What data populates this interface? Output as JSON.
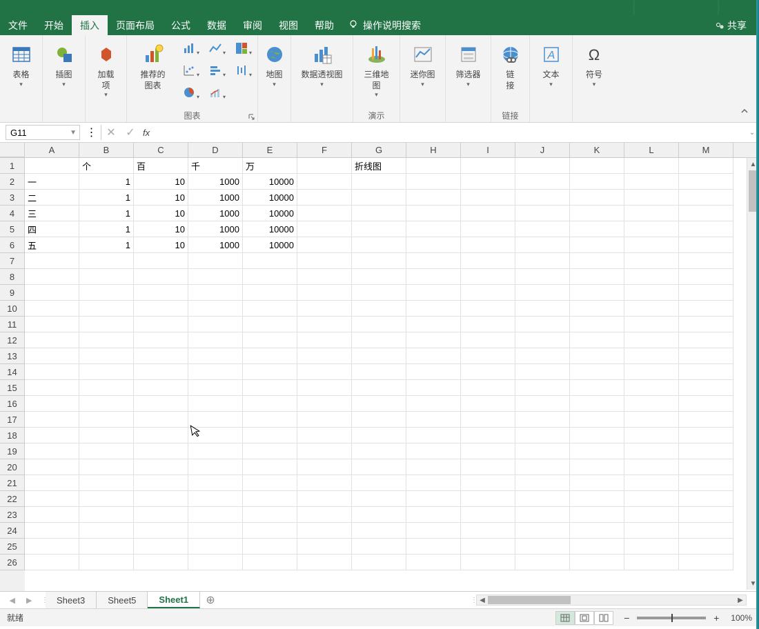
{
  "menubar": {
    "items": [
      "文件",
      "开始",
      "插入",
      "页面布局",
      "公式",
      "数据",
      "审阅",
      "视图",
      "帮助"
    ],
    "active_index": 2,
    "search_placeholder": "操作说明搜索",
    "share_label": "共享"
  },
  "ribbon": {
    "groups": {
      "tables": {
        "btn_table": "表格"
      },
      "illustrations": {
        "btn_pictures": "插图"
      },
      "addins": {
        "btn_addins": "加载\n项"
      },
      "charts": {
        "label": "图表",
        "btn_recommended": "推荐的\n图表"
      },
      "maps": {
        "btn_maps": "地图"
      },
      "pivot": {
        "btn_pivot": "数据透视图"
      },
      "tours": {
        "label": "演示",
        "btn_3dmap": "三维地\n图"
      },
      "sparklines": {
        "btn_sparklines": "迷你图"
      },
      "filters": {
        "btn_slicer": "筛选器"
      },
      "links": {
        "label": "链接",
        "btn_link": "链\n接"
      },
      "text": {
        "btn_text": "文本"
      },
      "symbols": {
        "btn_symbol": "符号"
      }
    }
  },
  "formula_bar": {
    "name_box": "G11",
    "fx_label": "fx",
    "formula_value": ""
  },
  "grid": {
    "columns": [
      "A",
      "B",
      "C",
      "D",
      "E",
      "F",
      "G",
      "H",
      "I",
      "J",
      "K",
      "L",
      "M"
    ],
    "row_count": 26,
    "data": [
      [
        "",
        "个",
        "百",
        "千",
        "万",
        "",
        "折线图"
      ],
      [
        "一",
        "1",
        "10",
        "1000",
        "10000"
      ],
      [
        "二",
        "1",
        "10",
        "1000",
        "10000"
      ],
      [
        "三",
        "1",
        "10",
        "1000",
        "10000"
      ],
      [
        "四",
        "1",
        "10",
        "1000",
        "10000"
      ],
      [
        "五",
        "1",
        "10",
        "1000",
        "10000"
      ]
    ],
    "numeric_cols": [
      1,
      2,
      3,
      4
    ]
  },
  "sheet_tabs": {
    "tabs": [
      "Sheet3",
      "Sheet5",
      "Sheet1"
    ],
    "active_index": 2
  },
  "status_bar": {
    "ready": "就绪",
    "zoom": "100%"
  }
}
